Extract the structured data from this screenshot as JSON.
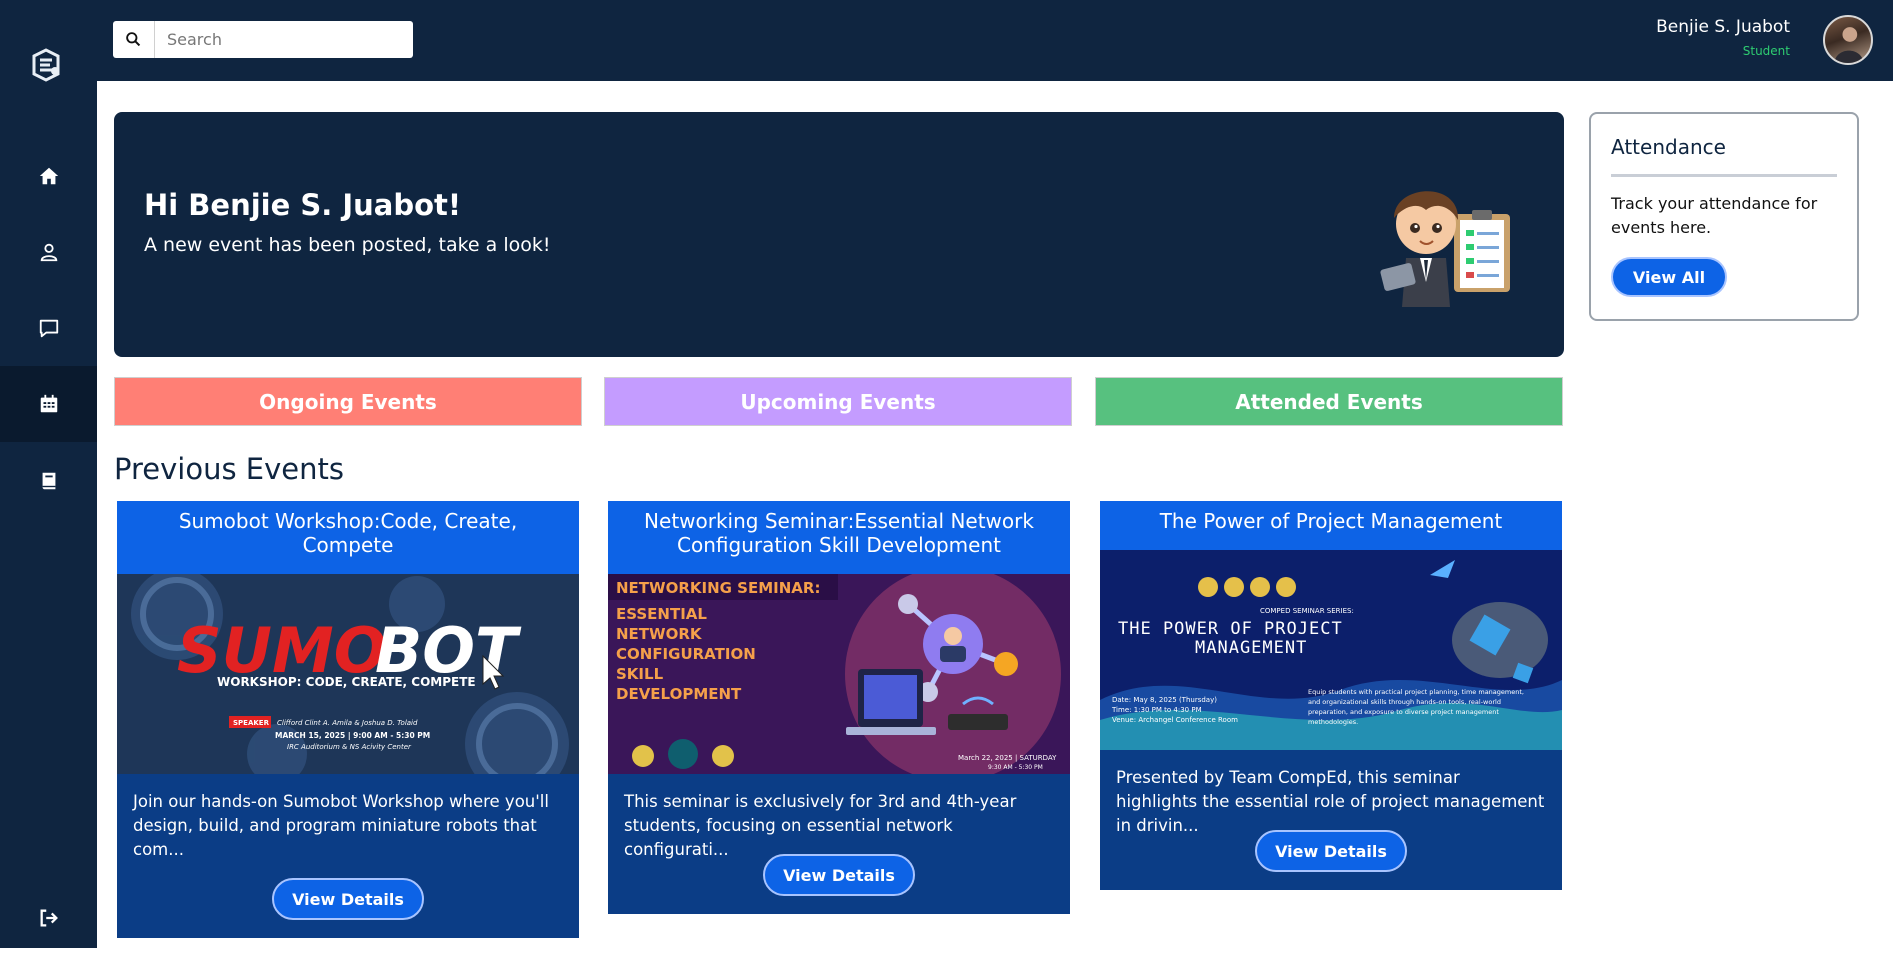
{
  "topbar": {
    "search_placeholder": "Search",
    "user_name": "Benjie S. Juabot",
    "user_role": "Student"
  },
  "sidebar": {
    "items": [
      {
        "name": "home-icon",
        "active": false
      },
      {
        "name": "user-icon",
        "active": false
      },
      {
        "name": "chat-icon",
        "active": false
      },
      {
        "name": "calendar-icon",
        "active": true
      },
      {
        "name": "book-icon",
        "active": false
      },
      {
        "name": "logout-icon",
        "active": false
      }
    ]
  },
  "hero": {
    "greeting": "Hi Benjie S. Juabot!",
    "subtitle": "A new event has been posted, take a look!"
  },
  "attendance": {
    "title": "Attendance",
    "text": "Track your attendance for events here.",
    "button": "View All"
  },
  "tabs": {
    "ongoing": "Ongoing Events",
    "upcoming": "Upcoming Events",
    "attended": "Attended Events"
  },
  "section_title": "Previous Events",
  "events": [
    {
      "title": "Sumobot Workshop:Code, Create, Compete",
      "poster": {
        "word1": "SUMO",
        "word2": "BOT",
        "tagline": "WORKSHOP: CODE, CREATE, COMPETE",
        "speaker_tag": "SPEAKER",
        "speakers": "Clifford Clint A. Amila & Joshua D. Tolaid",
        "date": "MARCH 15, 2025 | 9:00 AM - 5:30 PM",
        "venue": "IRC Auditorium & NS Acivity Center"
      },
      "description": "Join our hands-on Sumobot Workshop where you'll design, build, and program miniature robots that com...",
      "button": "View Details"
    },
    {
      "title": "Networking Seminar:Essential Network Configuration Skill Development",
      "poster": {
        "banner": "NETWORKING SEMINAR:",
        "lines": [
          "ESSENTIAL",
          "NETWORK",
          "CONFIGURATION",
          "SKILL",
          "DEVELOPMENT"
        ],
        "date": "March 22, 2025 | SATURDAY",
        "time": "9:30 AM - 5:30 PM"
      },
      "description": "This seminar is exclusively for 3rd and 4th-year students, focusing on essential network configurati...",
      "button": "View Details"
    },
    {
      "title": "The Power of Project Management",
      "poster": {
        "series": "COMPED SEMINAR SERIES:",
        "heading1": "THE POWER OF PROJECT",
        "heading2": "MANAGEMENT",
        "date": "Date: May 8, 2025 (Thursday)",
        "time": "Time: 1:30 PM to 4:30 PM",
        "venue": "Venue: Archangel Conference Room",
        "blurb1": "Equip students with practical project planning, time management,",
        "blurb2": "and organizational skills through hands-on tools, real-world",
        "blurb3": "preparation, and exposure to diverse project management",
        "blurb4": "methodologies."
      },
      "description": "Presented by Team CompEd, this seminar highlights the essential role of project management in drivin...",
      "button": "View Details"
    }
  ]
}
